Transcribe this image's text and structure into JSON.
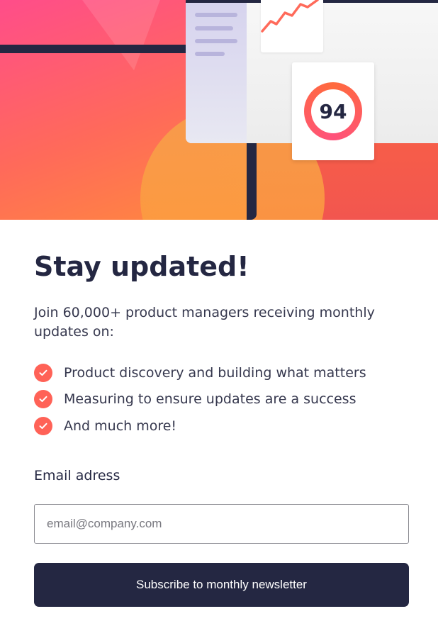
{
  "hero": {
    "score_value": "94",
    "colors": {
      "primary": "#242742",
      "accent": "#ff6257",
      "gradient_start": "#ff527b",
      "gradient_end": "#ff6a3d"
    }
  },
  "signup": {
    "title": "Stay updated!",
    "intro": "Join 60,000+ product managers receiving monthly updates on:",
    "features": [
      {
        "icon": "check-icon",
        "text": "Product discovery and building what matters"
      },
      {
        "icon": "check-icon",
        "text": "Measuring to ensure updates are a success"
      },
      {
        "icon": "check-icon",
        "text": "And much more!"
      }
    ],
    "email_label": "Email adress",
    "email_placeholder": "email@company.com",
    "email_value": "",
    "subscribe_label": "Subscribe to monthly newsletter"
  }
}
